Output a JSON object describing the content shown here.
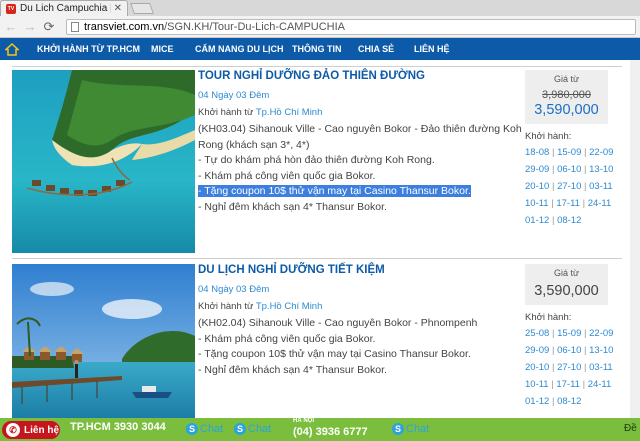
{
  "browser": {
    "tab_title": "Du Lich Campuchia | Tour",
    "url_host": "transviet.com.vn",
    "url_path": "/SGN.KH/Tour-Du-Lich-CAMPUCHIA"
  },
  "nav": {
    "items": [
      "KHỞI HÀNH TỪ TP.HCM",
      "MICE",
      "CẨM NANG DU LỊCH",
      "THÔNG TIN",
      "CHIA SẺ",
      "LIÊN HỆ"
    ]
  },
  "tours": [
    {
      "title": "TOUR NGHỈ DƯỠNG ĐẢO THIÊN ĐƯỜNG",
      "duration": "04 Ngày 03 Đêm",
      "depart_label": "Khởi hành từ",
      "depart_city": "Tp.Hồ Chí Minh",
      "lines": [
        "(KH03.04) Sihanouk Ville - Cao nguyên Bokor - Đảo thiên đường Koh Rong (khách sạn 3*, 4*)",
        "- Tự do khám phá hòn đảo thiên đường Koh Rong.",
        "- Khám phá công viên quốc gia Bokor.",
        "- Tặng coupon 10$ thử vận may tại Casino Thansur Bokor.",
        "- Nghỉ đêm khách sạn 4* Thansur Bokor."
      ],
      "price_from": "Giá từ",
      "price_old": "3,980,000",
      "price_new": "3,590,000",
      "dates_label": "Khởi hành:",
      "dates": [
        [
          "18-08",
          "15-09",
          "22-09"
        ],
        [
          "29-09",
          "06-10",
          "13-10"
        ],
        [
          "20-10",
          "27-10",
          "03-11"
        ],
        [
          "10-11",
          "17-11",
          "24-11"
        ],
        [
          "01-12",
          "08-12"
        ]
      ]
    },
    {
      "title": "DU LỊCH NGHỈ DƯỠNG TIẾT KIỆM",
      "duration": "04 Ngày 03 Đêm",
      "depart_label": "Khởi hành từ",
      "depart_city": "Tp.Hồ Chí Minh",
      "lines": [
        "(KH02.04) Sihanouk Ville - Cao nguyên Bokor - Phnompenh",
        "- Khám phá công viên quốc gia Bokor.",
        "- Tặng coupon 10$ thử vận may tại Casino Thansur Bokor.",
        "- Nghỉ đêm khách sạn 4* Thansur Bokor."
      ],
      "price_from": "Giá từ",
      "price": "3,590,000",
      "dates_label": "Khởi hành:",
      "dates": [
        [
          "25-08",
          "15-09",
          "22-09"
        ],
        [
          "29-09",
          "06-10",
          "13-10"
        ],
        [
          "20-10",
          "27-10",
          "03-11"
        ],
        [
          "10-11",
          "17-11",
          "24-11"
        ],
        [
          "01-12",
          "08-12"
        ]
      ]
    }
  ],
  "bottom": {
    "contact": "Liên hệ",
    "hcm_phone": "TP.HCM 3930 3044",
    "skype_label": "Chat",
    "hanoi_label": "HÀ NỘI",
    "hanoi_phone": "(04) 3936 6777",
    "right_text": "Đề"
  },
  "colors": {
    "nav_bg": "#0d5ba8",
    "title": "#0d5ba8",
    "link": "#2d8ad1",
    "bottom_bar": "#7bbe3d",
    "contact_btn": "#c5161d"
  }
}
